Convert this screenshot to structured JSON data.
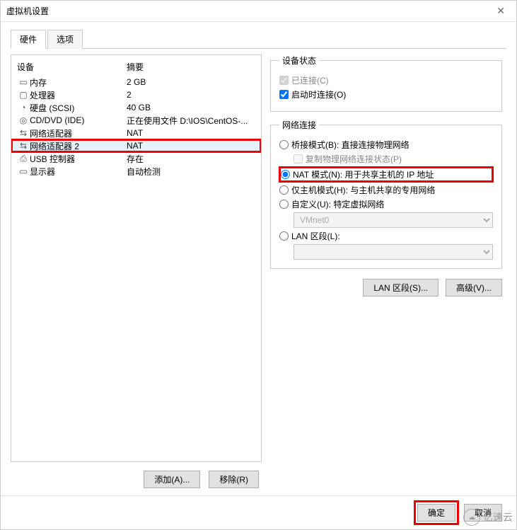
{
  "window": {
    "title": "虚拟机设置"
  },
  "tabs": {
    "hardware": "硬件",
    "options": "选项"
  },
  "device_table": {
    "header": {
      "device": "设备",
      "summary": "摘要"
    },
    "rows": [
      {
        "icon": "▭",
        "name": "内存",
        "summary": "2 GB"
      },
      {
        "icon": "▢",
        "name": "处理器",
        "summary": "2"
      },
      {
        "icon": "◔",
        "name": "硬盘 (SCSI)",
        "summary": "40 GB"
      },
      {
        "icon": "◎",
        "name": "CD/DVD (IDE)",
        "summary": "正在使用文件 D:\\IOS\\CentOS-..."
      },
      {
        "icon": "⇆",
        "name": "网络适配器",
        "summary": "NAT"
      },
      {
        "icon": "⇆",
        "name": "网络适配器 2",
        "summary": "NAT",
        "selected": true,
        "highlight": true
      },
      {
        "icon": "⎙",
        "name": "USB 控制器",
        "summary": "存在"
      },
      {
        "icon": "▭",
        "name": "显示器",
        "summary": "自动检测"
      }
    ]
  },
  "left_buttons": {
    "add": "添加(A)...",
    "remove": "移除(R)"
  },
  "device_status": {
    "legend": "设备状态",
    "connected": "已连接(C)",
    "connect_at_poweron": "启动时连接(O)"
  },
  "network": {
    "legend": "网络连接",
    "bridged": "桥接模式(B): 直接连接物理网络",
    "replicate": "复制物理网络连接状态(P)",
    "nat": "NAT 模式(N): 用于共享主机的 IP 地址",
    "hostonly": "仅主机模式(H): 与主机共享的专用网络",
    "custom": "自定义(U): 特定虚拟网络",
    "vmnet_value": "VMnet0",
    "lan_segment": "LAN 区段(L):",
    "lan_segment_value": "",
    "btn_lan": "LAN 区段(S)...",
    "btn_adv": "高级(V)..."
  },
  "footer": {
    "ok": "确定",
    "cancel": "取消"
  },
  "watermark": {
    "text": "亿速云"
  }
}
